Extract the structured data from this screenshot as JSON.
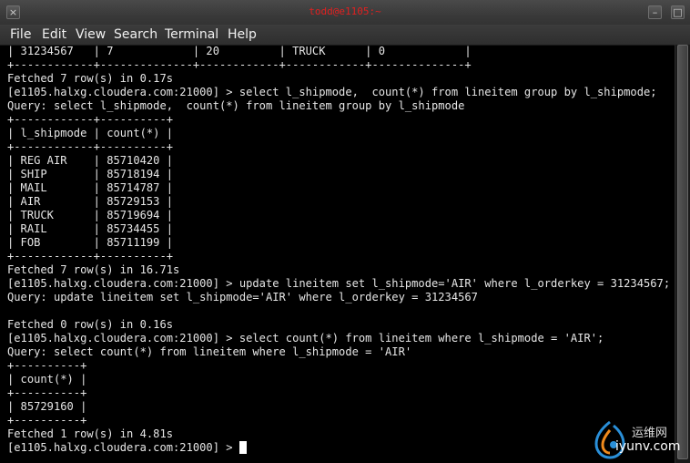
{
  "window": {
    "title": "todd@e1105:~",
    "buttons": {
      "minimize": "–",
      "maximize": "□",
      "close": "×"
    }
  },
  "menu": {
    "file": "File",
    "edit": "Edit",
    "view": "View",
    "search": "Search",
    "terminal": "Terminal",
    "help": "Help"
  },
  "terminal": {
    "lines": [
      "| 31234567   | 7            | 20         | TRUCK      | 0            |",
      "+------------+--------------+------------+------------+--------------+",
      "Fetched 7 row(s) in 0.17s",
      "[e1105.halxg.cloudera.com:21000] > select l_shipmode,  count(*) from lineitem group by l_shipmode;",
      "Query: select l_shipmode,  count(*) from lineitem group by l_shipmode",
      "+------------+----------+",
      "| l_shipmode | count(*) |",
      "+------------+----------+",
      "| REG AIR    | 85710420 |",
      "| SHIP       | 85718194 |",
      "| MAIL       | 85714787 |",
      "| AIR        | 85729153 |",
      "| TRUCK      | 85719694 |",
      "| RAIL       | 85734455 |",
      "| FOB        | 85711199 |",
      "+------------+----------+",
      "Fetched 7 row(s) in 16.71s",
      "[e1105.halxg.cloudera.com:21000] > update lineitem set l_shipmode='AIR' where l_orderkey = 31234567;",
      "Query: update lineitem set l_shipmode='AIR' where l_orderkey = 31234567",
      "",
      "Fetched 0 row(s) in 0.16s",
      "[e1105.halxg.cloudera.com:21000] > select count(*) from lineitem where l_shipmode = 'AIR';",
      "Query: select count(*) from lineitem where l_shipmode = 'AIR'",
      "+----------+",
      "| count(*) |",
      "+----------+",
      "| 85729160 |",
      "+----------+",
      "Fetched 1 row(s) in 4.81s"
    ],
    "prompt": "[e1105.halxg.cloudera.com:21000] > "
  },
  "watermark": {
    "cn": "运维网",
    "url": "iyunv.com"
  },
  "colors": {
    "title_text": "#e02020",
    "terminal_bg": "#000000",
    "terminal_fg": "#e6e6e6",
    "watermark_blue": "#2a8fd8",
    "watermark_orange": "#f08a1c"
  }
}
